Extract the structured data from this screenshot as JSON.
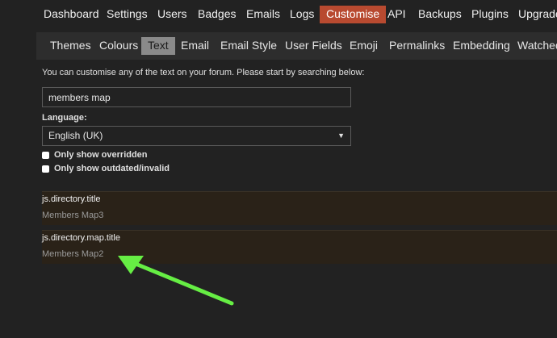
{
  "top_nav": {
    "items": [
      "Dashboard",
      "Settings",
      "Users",
      "Badges",
      "Emails",
      "Logs",
      "Customise",
      "API",
      "Backups",
      "Plugins",
      "Upgrade"
    ],
    "active": "Customise"
  },
  "sub_nav": {
    "items": [
      "Themes",
      "Colours",
      "Text",
      "Email",
      "Email Style",
      "User Fields",
      "Emoji",
      "Permalinks",
      "Embedding",
      "Watched"
    ],
    "active": "Text"
  },
  "intro_text": "You can customise any of the text on your forum. Please start by searching below:",
  "search": {
    "value": "members map"
  },
  "language": {
    "label": "Language:",
    "selected": "English (UK)"
  },
  "filters": {
    "overridden": "Only show overridden",
    "outdated": "Only show outdated/invalid"
  },
  "results": [
    {
      "key": "js.directory.title",
      "value": "Members Map3"
    },
    {
      "key": "js.directory.map.title",
      "value": "Members Map2"
    }
  ],
  "colors": {
    "active_tab": "#b84a30",
    "active_subtab": "#8a8a8a",
    "arrow": "#66ee44",
    "result_bg": "#2a2218"
  }
}
